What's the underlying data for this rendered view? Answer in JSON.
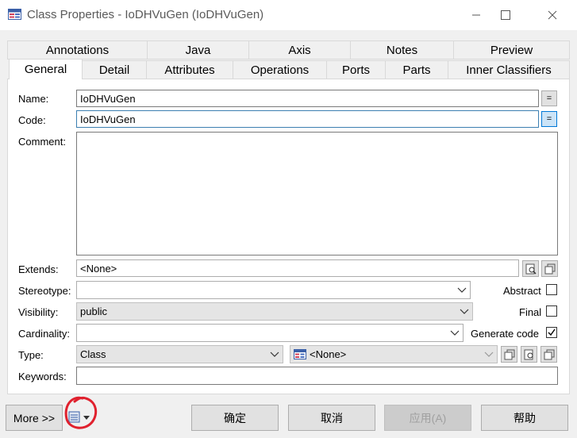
{
  "window": {
    "title": "Class Properties - IoDHVuGen (IoDHVuGen)",
    "icons": {
      "app": "class-table-icon",
      "minimize": "minimize-icon",
      "maximize": "maximize-icon",
      "close": "close-icon"
    }
  },
  "tabs": {
    "row1": [
      "Annotations",
      "Java",
      "Axis",
      "Notes",
      "Preview"
    ],
    "row2": [
      "General",
      "Detail",
      "Attributes",
      "Operations",
      "Ports",
      "Parts",
      "Inner Classifiers"
    ],
    "active": "General"
  },
  "form": {
    "name": {
      "label": "Name:",
      "value": "IoDHVuGen",
      "eq": "="
    },
    "code": {
      "label": "Code:",
      "value": "IoDHVuGen",
      "eq": "="
    },
    "comment": {
      "label": "Comment:",
      "value": ""
    },
    "extends": {
      "label": "Extends:",
      "value": "<None>"
    },
    "stereotype": {
      "label": "Stereotype:",
      "value": ""
    },
    "visibility": {
      "label": "Visibility:",
      "value": "public"
    },
    "cardinality": {
      "label": "Cardinality:",
      "value": ""
    },
    "type": {
      "label": "Type:",
      "value": "Class",
      "classifier": "<None>"
    },
    "keywords": {
      "label": "Keywords:",
      "value": ""
    },
    "abstract": {
      "label": "Abstract",
      "checked": false
    },
    "final": {
      "label": "Final",
      "checked": false
    },
    "generate_code": {
      "label": "Generate code",
      "checked": true
    }
  },
  "footer": {
    "more": "More >>",
    "ok": "确定",
    "cancel": "取消",
    "apply": "应用(A)",
    "help": "帮助"
  },
  "colors": {
    "accent": "#0078d7",
    "annotation": "#e0212e"
  }
}
